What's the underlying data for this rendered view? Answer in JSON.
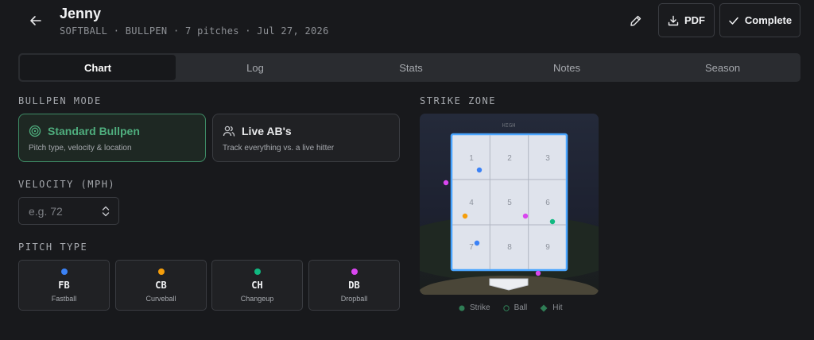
{
  "header": {
    "title": "Jenny",
    "subtitle": "SOFTBALL · BULLPEN · 7 pitches · Jul 27, 2026",
    "pdf_label": "PDF",
    "complete_label": "Complete"
  },
  "tabs": [
    {
      "label": "Chart",
      "active": true
    },
    {
      "label": "Log"
    },
    {
      "label": "Stats"
    },
    {
      "label": "Notes"
    },
    {
      "label": "Season"
    }
  ],
  "bullpen_mode": {
    "label": "BULLPEN MODE",
    "options": [
      {
        "title": "Standard Bullpen",
        "desc": "Pitch type, velocity & location",
        "selected": true,
        "icon": "target-icon"
      },
      {
        "title": "Live AB's",
        "desc": "Track everything vs. a live hitter",
        "icon": "users-icon"
      }
    ]
  },
  "velocity": {
    "label": "VELOCITY (MPH)",
    "placeholder": "e.g. 72"
  },
  "pitch_type": {
    "label": "PITCH TYPE",
    "options": [
      {
        "abbr": "FB",
        "name": "Fastball",
        "color": "#3b82f6"
      },
      {
        "abbr": "CB",
        "name": "Curveball",
        "color": "#f59e0b"
      },
      {
        "abbr": "CH",
        "name": "Changeup",
        "color": "#10b981"
      },
      {
        "abbr": "DB",
        "name": "Dropball",
        "color": "#d946ef"
      }
    ]
  },
  "strike_zone": {
    "label": "STRIKE ZONE",
    "high_label": "HIGH",
    "zones": [
      "1",
      "2",
      "3",
      "4",
      "5",
      "6",
      "7",
      "8",
      "9"
    ],
    "legend": [
      "Strike",
      "Ball",
      "Hit"
    ],
    "colors": {
      "strike": "#2f7d55",
      "ball": "#1a1b1e",
      "hit": "#2f7d55"
    }
  }
}
